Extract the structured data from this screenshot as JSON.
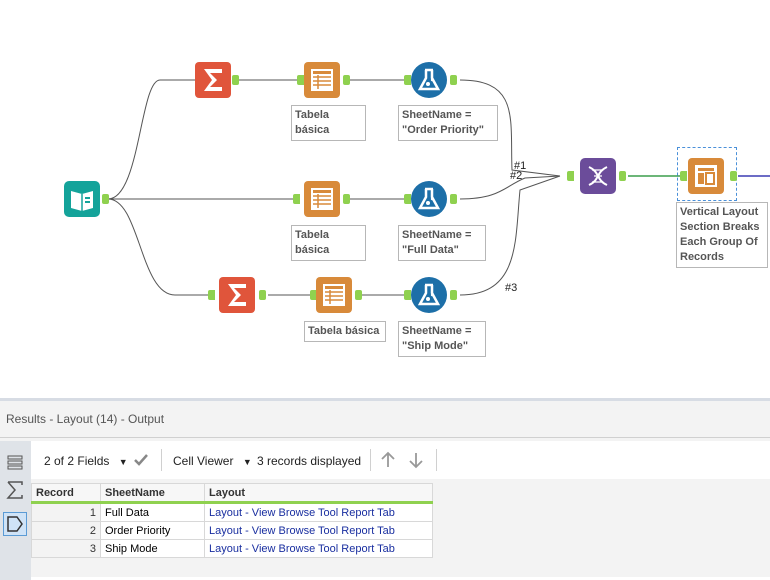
{
  "workflow": {
    "annotations": {
      "table1": "Tabela básica",
      "table2": "Tabela básica",
      "table3": "Tabela básica",
      "formula1_line1": "SheetName =",
      "formula1_line2": "\"Order Priority\"",
      "formula2_line1": "SheetName =",
      "formula2_line2": "\"Full Data\"",
      "formula3_line1": "SheetName =",
      "formula3_line2": "\"Ship Mode\"",
      "layout_line1": "Vertical Layout",
      "layout_line2": "Section Breaks",
      "layout_line3": "Each Group Of",
      "layout_line4": "Records"
    },
    "connection_labels": {
      "c1": "#1",
      "c2": "#2",
      "c3": "#3"
    },
    "colors": {
      "input": "#14a39a",
      "summarize": "#e0553b",
      "table": "#d88a3a",
      "formula": "#1d6fa8",
      "union": "#6b4c9a",
      "layout": "#d88a3a",
      "anchor": "#8fd14f"
    }
  },
  "results": {
    "title": "Results - Layout (14) - Output",
    "fields_select": "2 of 2 Fields",
    "viewer_select": "Cell Viewer",
    "records_displayed": "3 records displayed",
    "columns": [
      "Record",
      "SheetName",
      "Layout"
    ],
    "rows": [
      {
        "record": "1",
        "sheet": "Full Data",
        "layout": "Layout - View Browse Tool Report Tab"
      },
      {
        "record": "2",
        "sheet": "Order Priority",
        "layout": "Layout - View Browse Tool Report Tab"
      },
      {
        "record": "3",
        "sheet": "Ship Mode",
        "layout": "Layout - View Browse Tool Report Tab"
      }
    ]
  }
}
